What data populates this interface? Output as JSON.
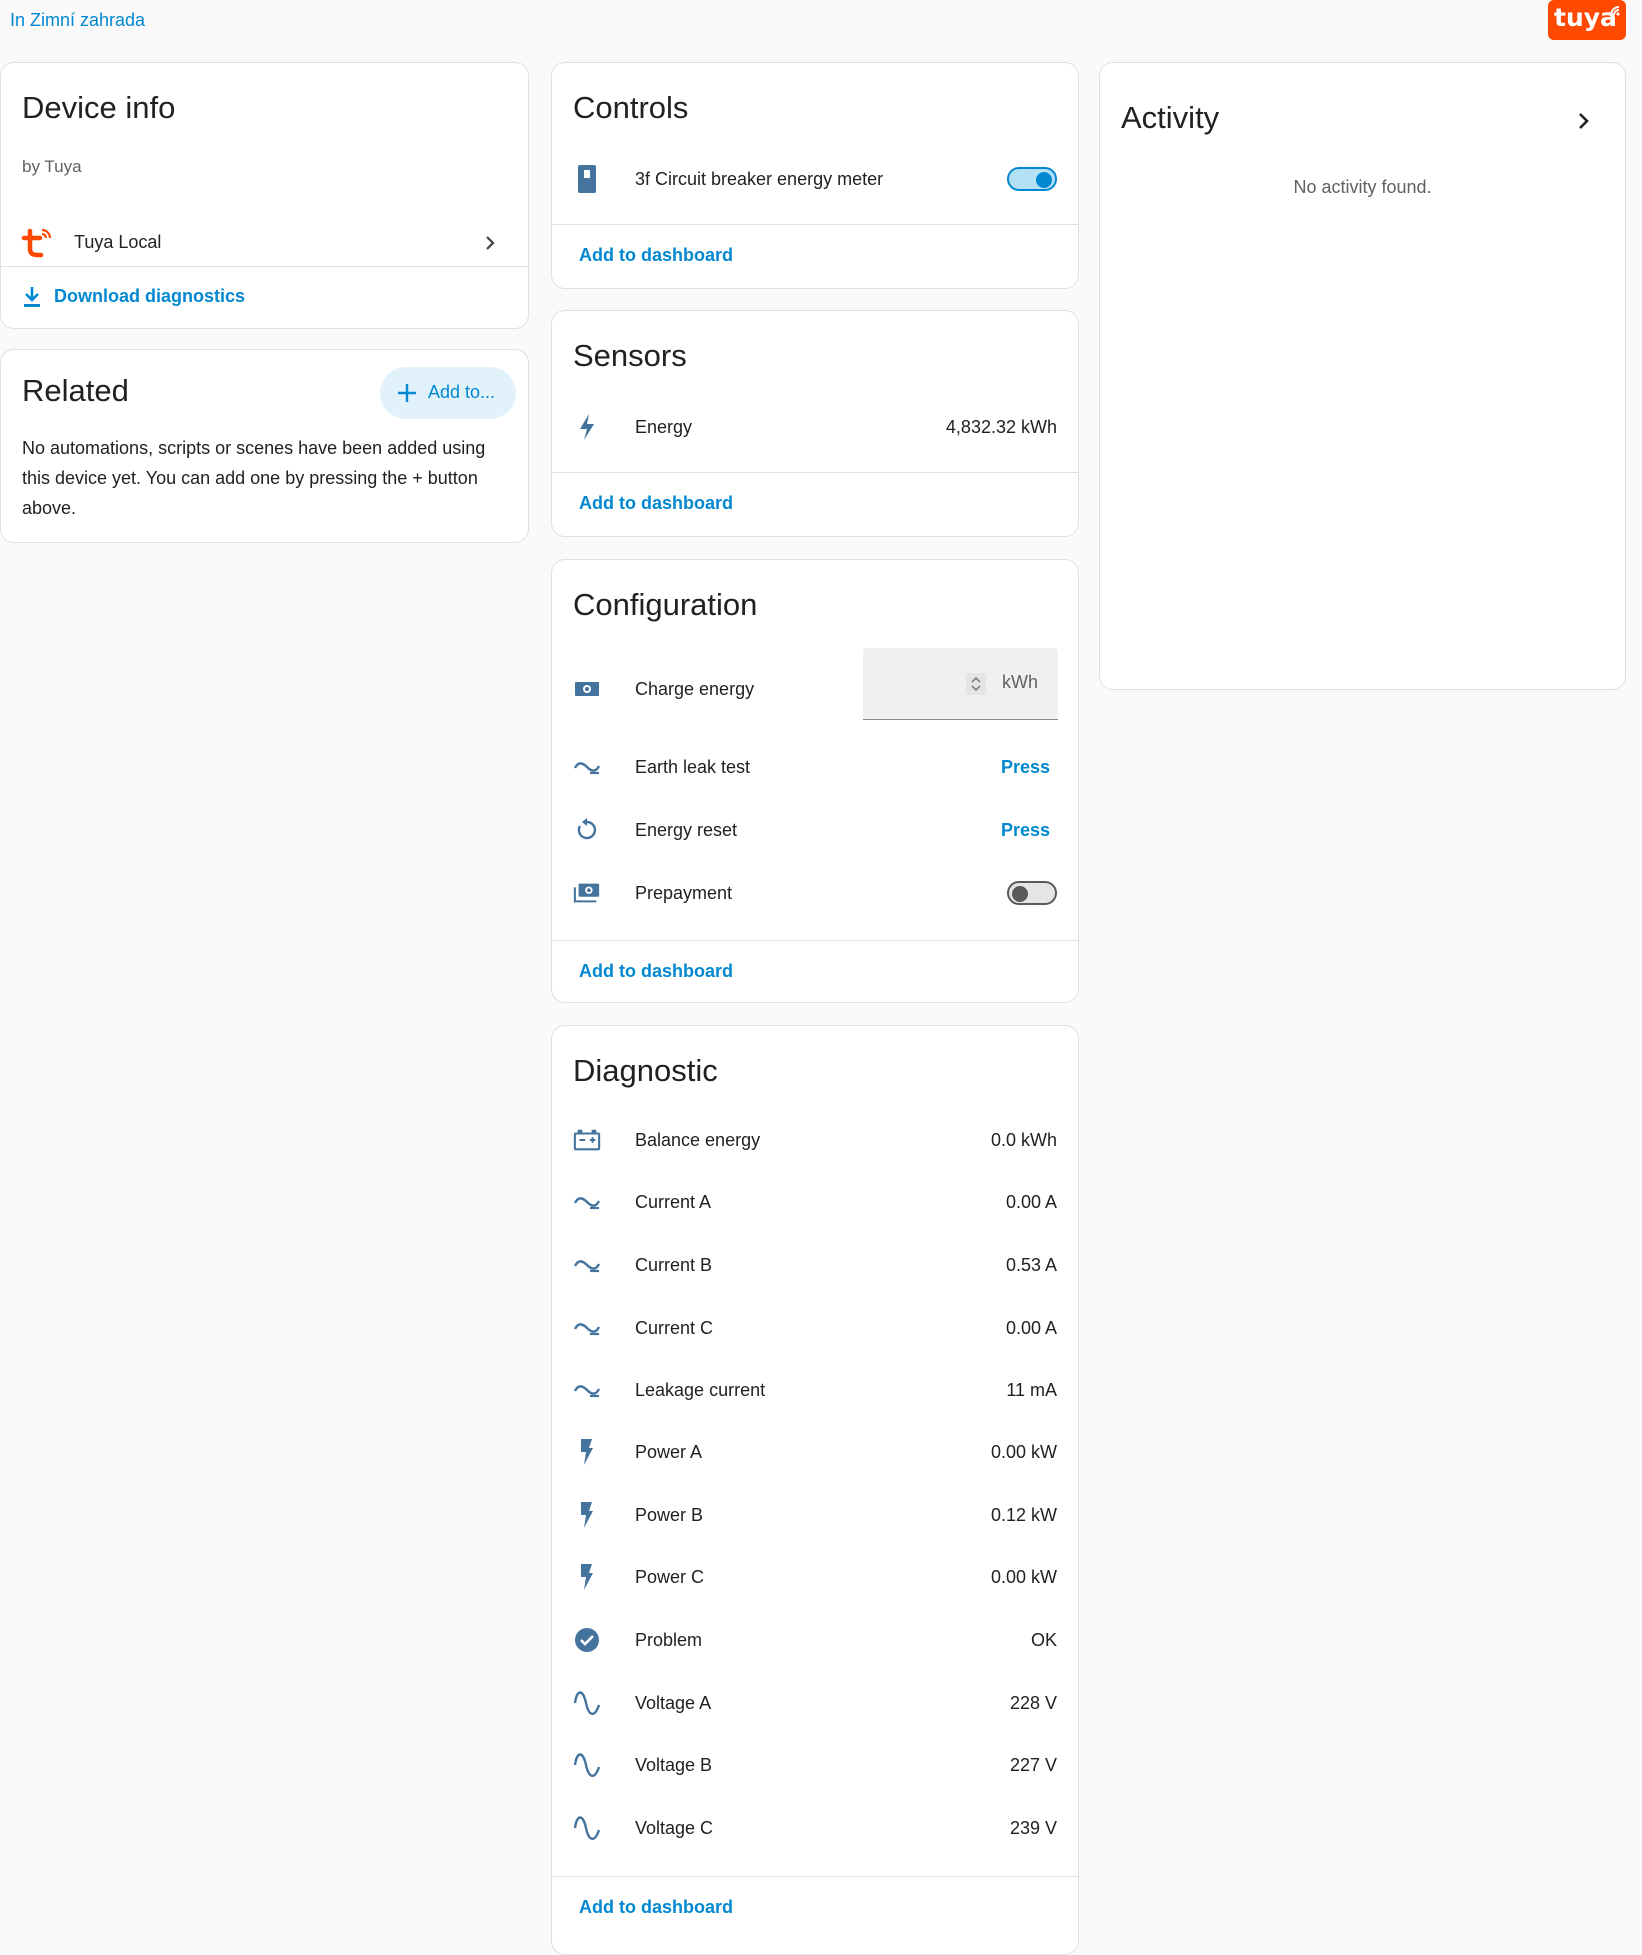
{
  "area_link": "In Zimní zahrada",
  "brand": {
    "logo_text": "tuya",
    "color": "#ff4800"
  },
  "accent": "#0288d1",
  "device_info": {
    "title": "Device info",
    "by": "by Tuya",
    "integration": "Tuya Local",
    "download": "Download diagnostics"
  },
  "related": {
    "title": "Related",
    "add_button": "Add to...",
    "body": "No automations, scripts or scenes have been added using this device yet. You can add one by pressing the + button above."
  },
  "controls": {
    "title": "Controls",
    "item_name": "3f Circuit breaker energy meter",
    "item_state": "on",
    "add_to_dashboard": "Add to dashboard"
  },
  "sensors": {
    "title": "Sensors",
    "item_name": "Energy",
    "item_value": "4,832.32 kWh",
    "add_to_dashboard": "Add to dashboard"
  },
  "configuration": {
    "title": "Configuration",
    "charge_energy": {
      "name": "Charge energy",
      "unit": "kWh",
      "value": ""
    },
    "earth_leak": {
      "name": "Earth leak test",
      "action": "Press"
    },
    "energy_reset": {
      "name": "Energy reset",
      "action": "Press"
    },
    "prepayment": {
      "name": "Prepayment",
      "state": "off"
    },
    "add_to_dashboard": "Add to dashboard"
  },
  "diagnostic": {
    "title": "Diagnostic",
    "items": [
      {
        "name": "Balance energy",
        "value": "0.0 kWh",
        "icon": "battery-plus-icon"
      },
      {
        "name": "Current A",
        "value": "0.00 A",
        "icon": "current-ac-icon"
      },
      {
        "name": "Current B",
        "value": "0.53 A",
        "icon": "current-ac-icon"
      },
      {
        "name": "Current C",
        "value": "0.00 A",
        "icon": "current-ac-icon"
      },
      {
        "name": "Leakage current",
        "value": "11 mA",
        "icon": "current-ac-icon"
      },
      {
        "name": "Power A",
        "value": "0.00 kW",
        "icon": "lightning-icon"
      },
      {
        "name": "Power B",
        "value": "0.12 kW",
        "icon": "lightning-icon"
      },
      {
        "name": "Power C",
        "value": "0.00 kW",
        "icon": "lightning-icon"
      },
      {
        "name": "Problem",
        "value": "OK",
        "icon": "check-circle-icon"
      },
      {
        "name": "Voltage A",
        "value": "228 V",
        "icon": "sine-wave-icon"
      },
      {
        "name": "Voltage B",
        "value": "227 V",
        "icon": "sine-wave-icon"
      },
      {
        "name": "Voltage C",
        "value": "239 V",
        "icon": "sine-wave-icon"
      }
    ],
    "add_to_dashboard": "Add to dashboard"
  },
  "activity": {
    "title": "Activity",
    "empty": "No activity found."
  }
}
